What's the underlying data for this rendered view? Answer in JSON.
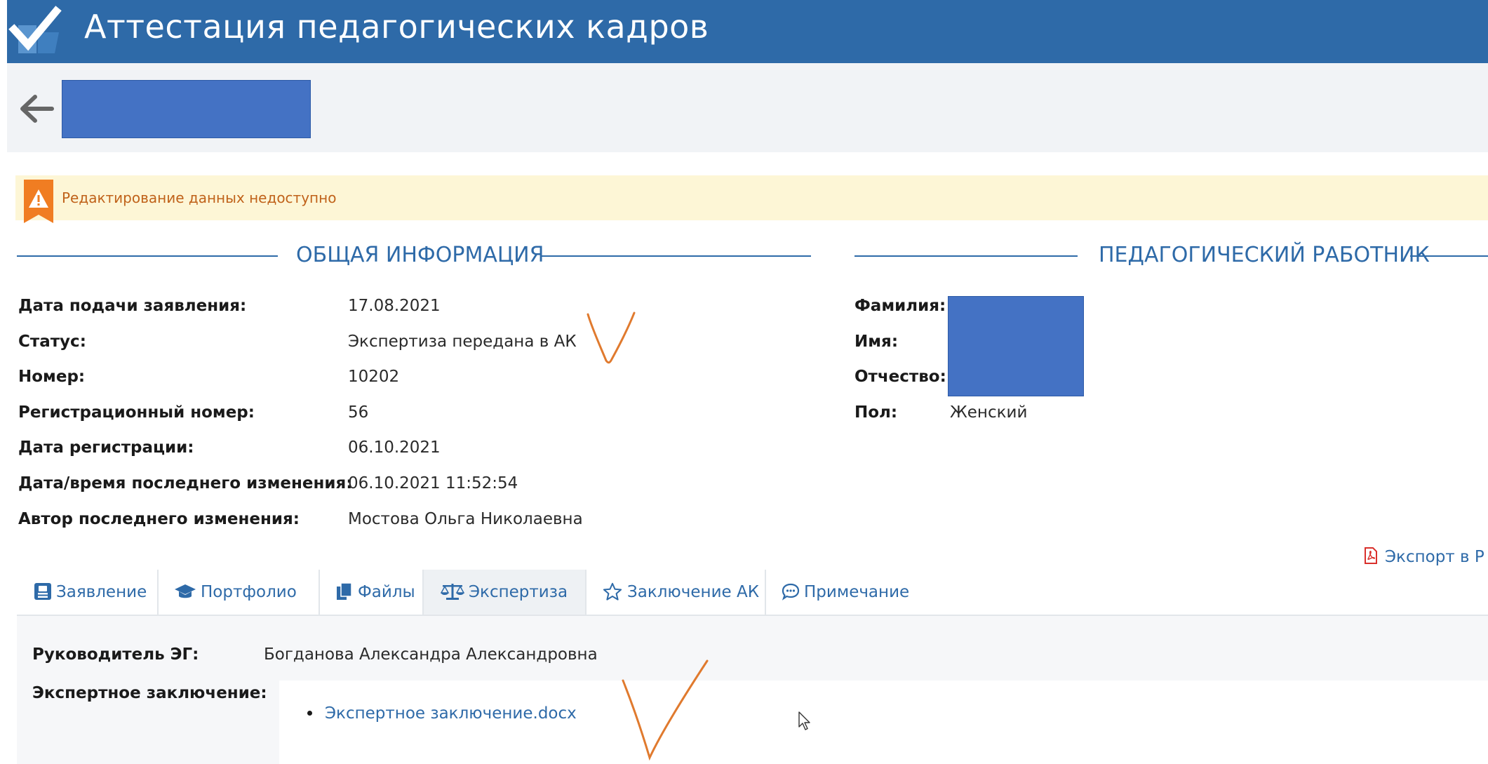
{
  "header": {
    "app_title": "Аттестация педагогических кадров",
    "logo_icon": "checkmark-logo-icon",
    "back_icon": "arrow-left-icon"
  },
  "warning": {
    "icon": "warning-triangle-icon",
    "text": "Редактирование данных недоступно"
  },
  "general_info": {
    "title": "ОБЩАЯ ИНФОРМАЦИЯ",
    "rows": [
      {
        "label": "Дата подачи заявления:",
        "value": "17.08.2021"
      },
      {
        "label": "Статус:",
        "value": "Экспертиза передана в АК"
      },
      {
        "label": "Номер:",
        "value": "10202"
      },
      {
        "label": "Регистрационный номер:",
        "value": "56"
      },
      {
        "label": "Дата регистрации:",
        "value": "06.10.2021"
      },
      {
        "label": "Дата/время последнего изменения:",
        "value": "06.10.2021 11:52:54"
      },
      {
        "label": "Автор последнего изменения:",
        "value": "Мостова Ольга Николаевна"
      }
    ]
  },
  "worker": {
    "title": "ПЕДАГОГИЧЕСКИЙ РАБОТНИК",
    "surname_label": "Фамилия:",
    "name_label": "Имя:",
    "patronymic_label": "Отчество:",
    "gender_label": "Пол:",
    "gender_value": "Женский"
  },
  "export": {
    "label": "Экспорт в Р",
    "icon": "pdf-icon"
  },
  "tabs": [
    {
      "label": "Заявление",
      "icon": "id-card-icon",
      "active": false
    },
    {
      "label": "Портфолио",
      "icon": "graduation-cap-icon",
      "active": false
    },
    {
      "label": "Файлы",
      "icon": "files-icon",
      "active": false
    },
    {
      "label": "Экспертиза",
      "icon": "scales-icon",
      "active": true
    },
    {
      "label": "Заключение АК",
      "icon": "star-icon",
      "active": false
    },
    {
      "label": "Примечание",
      "icon": "comment-icon",
      "active": false
    }
  ],
  "expertise": {
    "head_label": "Руководитель ЭГ:",
    "head_value": "Богданова Александра Александровна",
    "conclusion_label": "Экспертное заключение:",
    "files": [
      "Экспертное заключение.docx"
    ]
  },
  "colors": {
    "header_bg": "#2e6aa8",
    "accent": "#2e6aa8",
    "warning_bg": "#fdf6d6",
    "warning_text": "#c0621a",
    "redaction": "#4472c4",
    "annotation": "#e07a2e"
  }
}
